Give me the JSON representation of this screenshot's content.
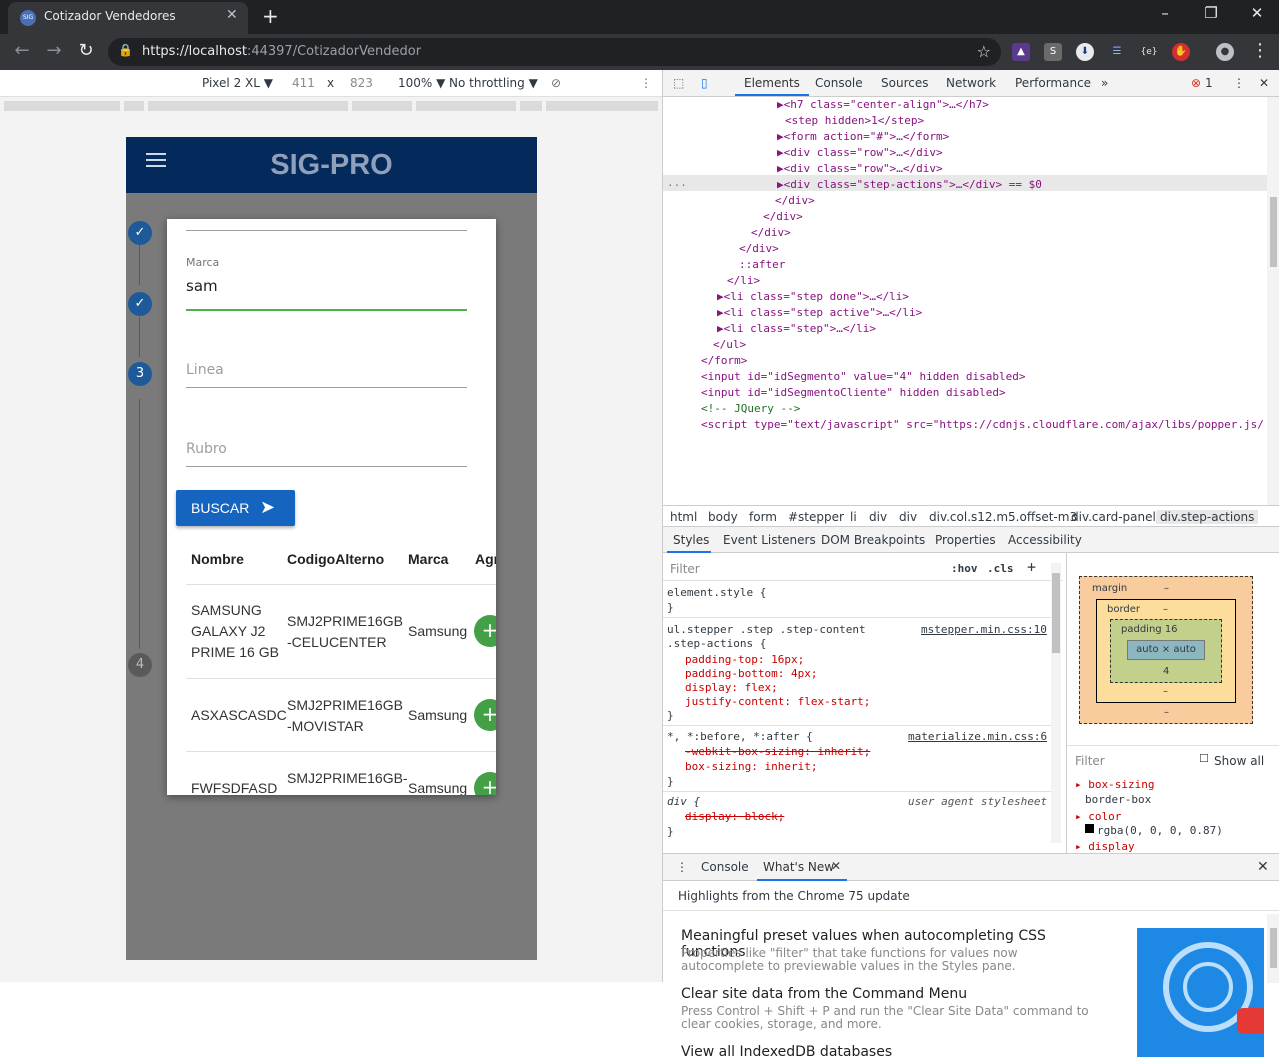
{
  "browser": {
    "tab_title": "Cotizador Vendedores",
    "favicon_text": "SIG",
    "url_host": "https://localhost",
    "url_rest": ":44397/CotizadorVendedor",
    "ext_labels": [
      "S",
      "{e}"
    ]
  },
  "device_toolbar": {
    "device": "Pixel 2 XL ▼",
    "width": "411",
    "x": "x",
    "height": "823",
    "zoom": "100% ▼",
    "throttle": "No throttling ▼"
  },
  "app": {
    "brand": "SIG-PRO",
    "steps": {
      "three": "3",
      "four": "4"
    },
    "fields": {
      "marca_label": "Marca",
      "marca_value": "sam",
      "linea_placeholder": "Linea",
      "rubro_placeholder": "Rubro"
    },
    "buscar_label": "BUSCAR",
    "table": {
      "headers": [
        "Nombre",
        "CodigoAlterno",
        "Marca",
        "Agr"
      ],
      "rows": [
        {
          "nombre": "SAMSUNG GALAXY J2 PRIME 16 GB",
          "codigo": "SMJ2PRIME16GB-CELUCENTER",
          "marca": "Samsung"
        },
        {
          "nombre": "ASXASCASDC",
          "codigo": "SMJ2PRIME16GB-MOVISTAR",
          "marca": "Samsung"
        },
        {
          "nombre": "FWFSDFASD",
          "codigo": "SMJ2PRIME16GB-",
          "marca": "Samsung"
        }
      ]
    }
  },
  "devtools": {
    "tabs": [
      "Elements",
      "Console",
      "Sources",
      "Network",
      "Performance",
      "»"
    ],
    "errors": "1",
    "dom_lines": [
      {
        "t": "▶<h7 class=\"center-align\">…</h7>"
      },
      {
        "t": "<step hidden>1</step>"
      },
      {
        "t": "▶<form action=\"#\">…</form>"
      },
      {
        "t": "▶<div class=\"row\">…</div>"
      },
      {
        "t": "▶<div class=\"row\">…</div>"
      },
      {
        "t": "▶<div class=\"step-actions\">…</div> == $0"
      },
      {
        "t": "</div>"
      },
      {
        "t": "</div>"
      },
      {
        "t": "</div>"
      },
      {
        "t": "</div>"
      },
      {
        "t": "::after"
      },
      {
        "t": "</li>"
      },
      {
        "t": "▶<li class=\"step done\">…</li>"
      },
      {
        "t": "▶<li class=\"step active\">…</li>"
      },
      {
        "t": "▶<li class=\"step\">…</li>"
      },
      {
        "t": "</ul>"
      },
      {
        "t": "</form>"
      },
      {
        "t": "<input id=\"idSegmento\" value=\"4\" hidden disabled>"
      },
      {
        "t": "<input id=\"idSegmentoCliente\" hidden disabled>"
      },
      {
        "t": "<!-- JQuery -->"
      },
      {
        "t": "<script type=\"text/javascript\" src=\"https://cdnjs.cloudflare.com/ajax/libs/popper.js/"
      }
    ],
    "dom_dots": "...",
    "breadcrumbs": [
      "html",
      "body",
      "form",
      "#stepper",
      "li",
      "div",
      "div",
      "div.col.s12.m5.offset-m3",
      "div.card-panel",
      "div.step-actions"
    ],
    "subtabs": [
      "Styles",
      "Event Listeners",
      "DOM Breakpoints",
      "Properties",
      "Accessibility"
    ],
    "filter_placeholder": "Filter",
    "hov": ":hov",
    "cls": ".cls",
    "styles": {
      "element_style": "element.style {",
      "close": "}",
      "rule1_selector": "ul.stepper .step .step-content",
      "rule1_selector2": ".step-actions {",
      "rule1_source": "mstepper.min.css:10",
      "rule1_props": [
        "padding-top: 16px;",
        "padding-bottom: 4px;",
        "display: flex;",
        "justify-content: flex-start;"
      ],
      "rule2_selector": "*, *:before, *:after {",
      "rule2_source": "materialize.min.css:6",
      "rule2_struck": "-webkit-box-sizing: inherit;",
      "rule2_prop": "box-sizing: inherit;",
      "rule3_selector": "div {",
      "rule3_source": "user agent stylesheet",
      "rule3_struck": "display: block;"
    },
    "boxmodel": {
      "margin": "margin",
      "border": "border",
      "padding": "padding 16",
      "content": "auto × auto",
      "dash": "–",
      "bottom_padding": "4"
    },
    "computed": {
      "filter": "Filter",
      "show_all": "Show all",
      "p1": "box-sizing",
      "v1": "border-box",
      "p2": "color",
      "v2": "rgba(0, 0, 0, 0.87)",
      "p3": "display"
    },
    "drawer": {
      "tabs": [
        "Console",
        "What's New"
      ],
      "headline": "Highlights from the Chrome 75 update",
      "items": [
        {
          "title": "Meaningful preset values when autocompleting CSS functions",
          "body": "Properties like \"filter\" that take functions for values now autocomplete to previewable values in the Styles pane."
        },
        {
          "title": "Clear site data from the Command Menu",
          "body": "Press Control + Shift + P and run the \"Clear Site Data\" command to clear cookies, storage, and more."
        },
        {
          "title": "View all IndexedDB databases",
          "body": ""
        }
      ]
    }
  }
}
